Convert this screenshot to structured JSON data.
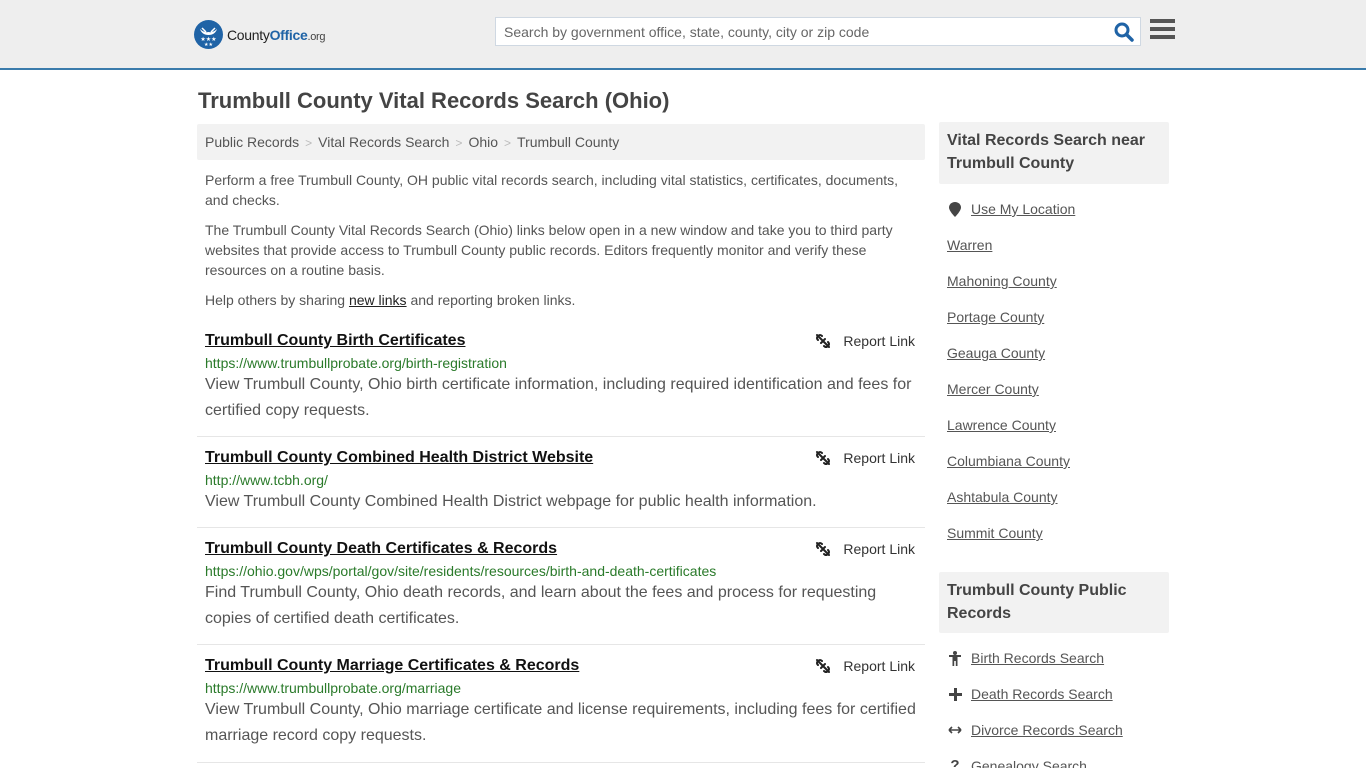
{
  "header": {
    "logo": {
      "name_part1": "County",
      "name_part2": "Office",
      "tld": ".org"
    },
    "search": {
      "placeholder": "Search by government office, state, county, city or zip code",
      "value": ""
    },
    "colors": {
      "brand": "#1f63a6",
      "accent_line": "#3a7bab",
      "topbar_bg": "#eeeeee"
    }
  },
  "page": {
    "title": "Trumbull County Vital Records Search (Ohio)",
    "breadcrumb": [
      {
        "label": "Public Records"
      },
      {
        "label": "Vital Records Search"
      },
      {
        "label": "Ohio"
      },
      {
        "label": "Trumbull County"
      }
    ],
    "breadcrumb_separator": ">",
    "intro": [
      "Perform a free Trumbull County, OH public vital records search, including vital statistics, certificates, documents, and checks.",
      "The Trumbull County Vital Records Search (Ohio) links below open in a new window and take you to third party websites that provide access to Trumbull County public records. Editors frequently monitor and verify these resources on a routine basis."
    ],
    "share": {
      "prefix": "Help others by sharing ",
      "link": "new links",
      "suffix": " and reporting broken links."
    }
  },
  "records": [
    {
      "title": "Trumbull County Birth Certificates",
      "url": "https://www.trumbullprobate.org/birth-registration",
      "description": "View Trumbull County, Ohio birth certificate information, including required identification and fees for certified copy requests.",
      "report_label": "Report Link"
    },
    {
      "title": "Trumbull County Combined Health District Website",
      "url": "http://www.tcbh.org/",
      "description": "View Trumbull County Combined Health District webpage for public health information.",
      "report_label": "Report Link"
    },
    {
      "title": "Trumbull County Death Certificates & Records",
      "url": "https://ohio.gov/wps/portal/gov/site/residents/resources/birth-and-death-certificates",
      "description": "Find Trumbull County, Ohio death records, and learn about the fees and process for requesting copies of certified death certificates.",
      "report_label": "Report Link"
    },
    {
      "title": "Trumbull County Marriage Certificates & Records",
      "url": "https://www.trumbullprobate.org/marriage",
      "description": "View Trumbull County, Ohio marriage certificate and license requirements, including fees for certified marriage record copy requests.",
      "report_label": "Report Link"
    }
  ],
  "sidebar": {
    "nearby": {
      "heading": "Vital Records Search near Trumbull County",
      "use_location": {
        "label": "Use My Location",
        "icon": "map-marker-icon"
      },
      "links": [
        "Warren",
        "Mahoning County",
        "Portage County",
        "Geauga County",
        "Mercer County",
        "Lawrence County",
        "Columbiana County",
        "Ashtabula County",
        "Summit County"
      ]
    },
    "public_records": {
      "heading": "Trumbull County Public Records",
      "links": [
        {
          "label": "Birth Records Search",
          "icon": "child-icon"
        },
        {
          "label": "Death Records Search",
          "icon": "plus-cross-icon"
        },
        {
          "label": "Divorce Records Search",
          "icon": "arrows-horizontal-icon"
        },
        {
          "label": "Genealogy Search",
          "icon": "question-icon"
        }
      ]
    }
  }
}
